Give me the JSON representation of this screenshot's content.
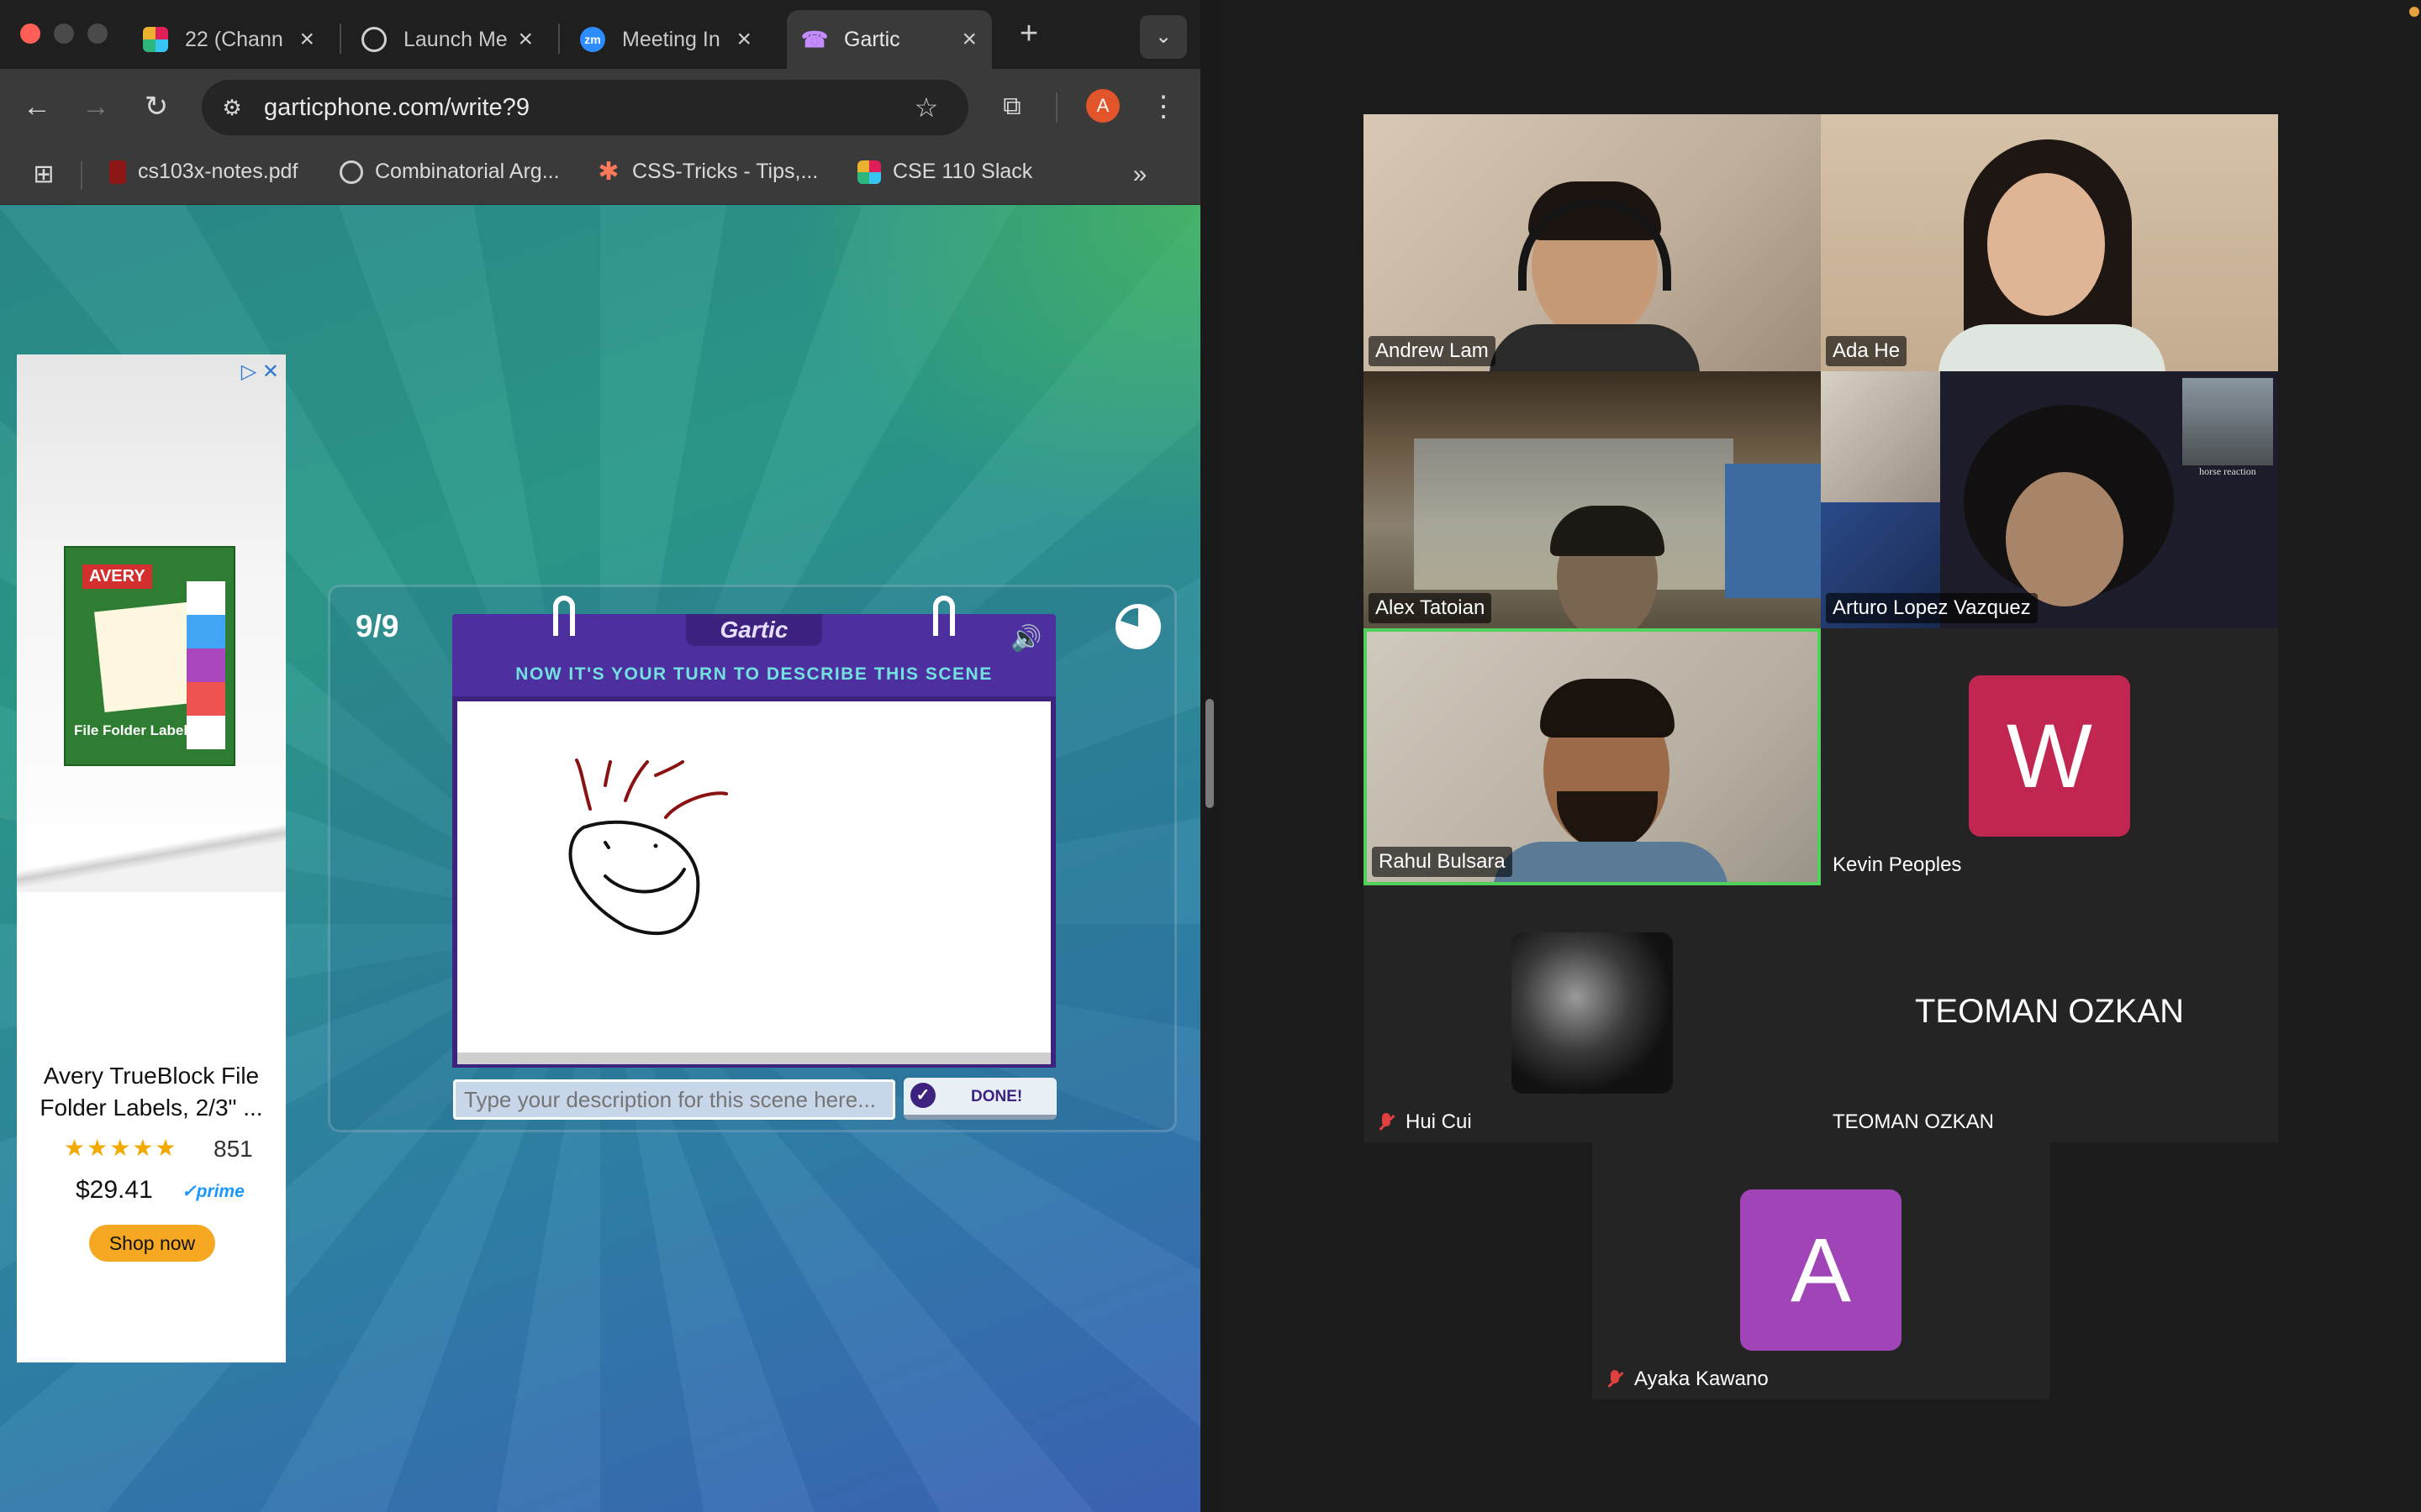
{
  "browser": {
    "tabs": [
      {
        "label": "22 (Chann",
        "icon": "slack-icon"
      },
      {
        "label": "Launch Me",
        "icon": "globe-icon"
      },
      {
        "label": "Meeting In",
        "icon": "zoom-icon"
      },
      {
        "label": "Gartic",
        "icon": "phone-icon",
        "active": true
      }
    ],
    "url": "garticphone.com/write?9",
    "profile_initial": "A",
    "bookmarks": [
      {
        "label": "cs103x-notes.pdf",
        "icon": "stanford-icon"
      },
      {
        "label": "Combinatorial Arg...",
        "icon": "globe-icon"
      },
      {
        "label": "CSS-Tricks - Tips,...",
        "icon": "star-icon"
      },
      {
        "label": "CSE 110 Slack",
        "icon": "slack-icon"
      }
    ]
  },
  "ad": {
    "brand": "AVERY",
    "product_label": "File Folder Labels",
    "title": "Avery TrueBlock File Folder Labels, 2/3\" ...",
    "stars": "★★★★★",
    "rating_count": "851",
    "price": "$29.41",
    "prime": "✓prime",
    "shop_label": "Shop now"
  },
  "game": {
    "round": "9/9",
    "logo": "Gartic",
    "prompt": "NOW IT'S YOUR TURN TO DESCRIBE THIS SCENE",
    "input_placeholder": "Type your description for this scene here...",
    "done_label": "DONE!"
  },
  "meeting": {
    "participants": [
      {
        "name": "Andrew Lam",
        "video": true
      },
      {
        "name": "Ada He",
        "video": true
      },
      {
        "name": "Alex Tatoian",
        "video": true
      },
      {
        "name": "Arturo Lopez Vazquez",
        "video": true,
        "overlay_text": "horse reaction"
      },
      {
        "name": "Rahul Bulsara",
        "video": true,
        "speaking": true
      },
      {
        "name": "Kevin Peoples",
        "initial": "W",
        "color": "#c0264f"
      },
      {
        "name": "Hui Cui",
        "muted": true,
        "avatar": true
      },
      {
        "name": "TEOMAN OZKAN",
        "display": "TEOMAN OZKAN"
      },
      {
        "name": "Ayaka Kawano",
        "initial": "A",
        "color": "#a044b8",
        "muted": true
      }
    ]
  }
}
